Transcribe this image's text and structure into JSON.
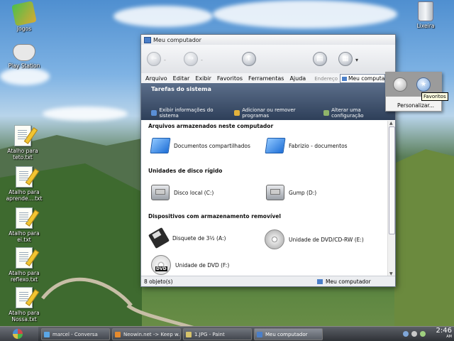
{
  "desktop": {
    "icons": [
      {
        "label": "Jogos",
        "icon": "games-icon"
      },
      {
        "label": "Play Station",
        "icon": "gamepad-icon"
      },
      {
        "label": "Atalho para teto.txt",
        "icon": "text-file-icon"
      },
      {
        "label": "Atalho para aprende....txt",
        "icon": "text-file-icon"
      },
      {
        "label": "Atalho para ei.txt",
        "icon": "text-file-icon"
      },
      {
        "label": "Atalho para reflexo.txt",
        "icon": "text-file-icon"
      },
      {
        "label": "Atalho para Nossa.txt",
        "icon": "text-file-icon"
      },
      {
        "label": "Lixeira",
        "icon": "recycle-bin-icon"
      }
    ]
  },
  "window": {
    "title": "Meu computador",
    "menu": [
      "Arquivo",
      "Editar",
      "Exibir",
      "Favoritos",
      "Ferramentas",
      "Ajuda"
    ],
    "address_label": "Endereço",
    "address_value": "Meu computador",
    "tasks": {
      "heading": "Tarefas do sistema",
      "links": [
        "Exibir informações do sistema",
        "Adicionar ou remover programas",
        "Alterar uma configuração"
      ]
    },
    "sections": [
      {
        "title": "Arquivos armazenados neste computador",
        "items": [
          {
            "label": "Documentos compartilhados",
            "icon": "folder-icon"
          },
          {
            "label": "Fabrizio - documentos",
            "icon": "folder-icon"
          }
        ]
      },
      {
        "title": "Unidades de disco rígido",
        "items": [
          {
            "label": "Disco local (C:)",
            "icon": "hard-drive-icon"
          },
          {
            "label": "Gump (D:)",
            "icon": "hard-drive-icon"
          }
        ]
      },
      {
        "title": "Dispositivos com armazenamento removível",
        "items": [
          {
            "label": "Disquete de 3½ (A:)",
            "icon": "floppy-icon"
          },
          {
            "label": "Unidade de DVD/CD-RW (E:)",
            "icon": "cd-drive-icon"
          },
          {
            "label": "Unidade de DVD (F:)",
            "icon": "dvd-drive-icon"
          }
        ]
      }
    ],
    "status": {
      "count": "8 objeto(s)",
      "location": "Meu computador"
    }
  },
  "flyout": {
    "customize": "Personalizar...",
    "tooltip": "Favoritos"
  },
  "taskbar": {
    "buttons": [
      "marcel - Conversa",
      "Neowin.net -> Keep w...",
      "1.JPG - Paint",
      "Meu computador"
    ],
    "active_index": 3,
    "time": "2:46",
    "time_suffix": "AM"
  }
}
